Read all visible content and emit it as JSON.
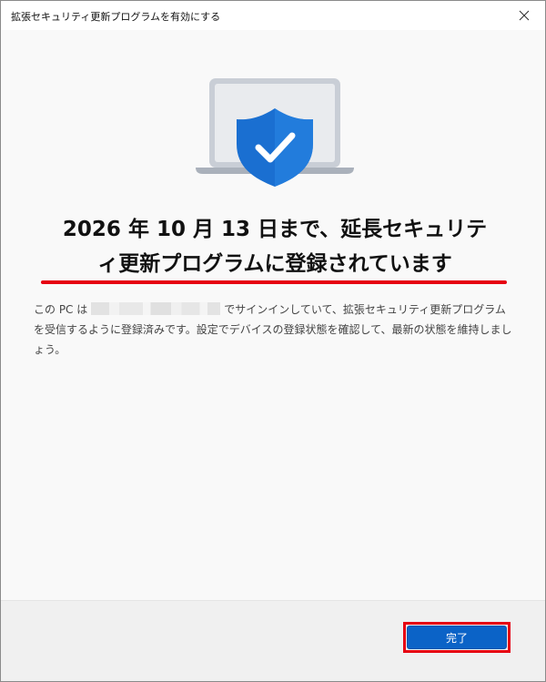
{
  "window": {
    "title": "拡張セキュリティ更新プログラムを有効にする",
    "close_symbol": "✕"
  },
  "icons": {
    "hero": "laptop-shield-check-icon",
    "close": "close-icon"
  },
  "content": {
    "headline_line1": "2026 年 10 月 13 日まで、延長セキュリテ",
    "headline_line2": "ィ更新プログラムに登録されています",
    "description_prefix": "この PC は",
    "description_rest": "でサインインしていて、拡張セキュリティ更新プログラムを受信するように登録済みです。設定でデバイスの登録状態を確認して、最新の状態を維持しましょう。"
  },
  "footer": {
    "done_label": "完了"
  },
  "colors": {
    "accent": "#0b63c7",
    "highlight": "#e60012"
  }
}
